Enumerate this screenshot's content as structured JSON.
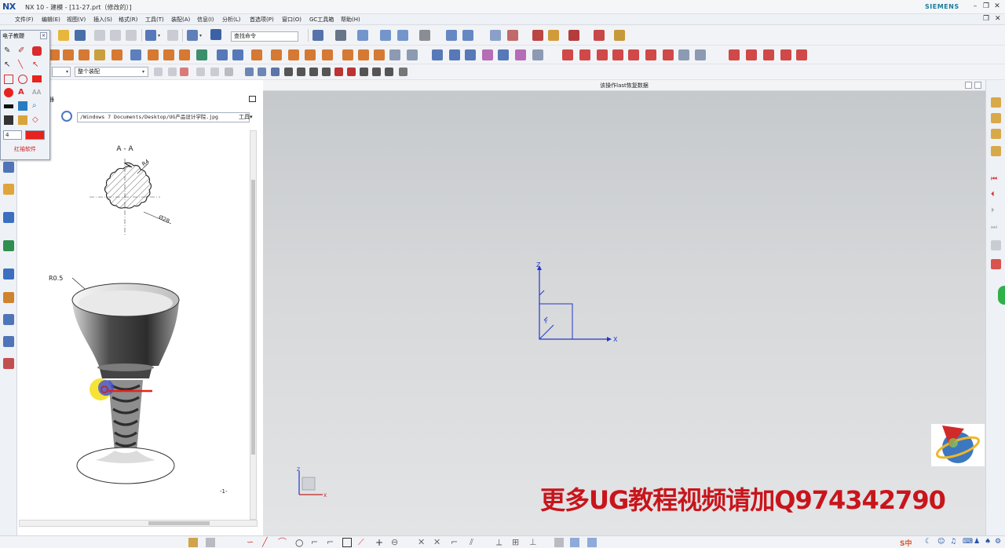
{
  "window": {
    "app_logo": "NX",
    "title": "NX 10 - 建模 - [11-27.prt（修改的）]",
    "brand": "SIEMENS",
    "controls": [
      "minimize-icon",
      "restore-icon",
      "close-icon"
    ]
  },
  "menu": {
    "items": [
      "文件(F)",
      "编辑(E)",
      "视图(V)",
      "插入(S)",
      "格式(R)",
      "工具(T)",
      "装配(A)",
      "信息(I)",
      "分析(L)",
      "首选项(P)",
      "窗口(O)",
      "GC工具箱",
      "帮助(H)"
    ]
  },
  "toolbar": {
    "search_placeholder": "查找命令",
    "selection_filter": "整个装配",
    "type_filter_value": ""
  },
  "palette": {
    "title": "电子教鞭",
    "close_label": "×",
    "line_width": "4",
    "footer": "红袖软件",
    "colors": {
      "red": "#e8221c",
      "black": "#111111"
    }
  },
  "browser": {
    "header_label": "器",
    "path": "/Windows 7 Documents/Desktop/UG产品设计学院.jpg",
    "tools_label": "工具▾",
    "drawing": {
      "section_label": "A - A",
      "dim_r": "R4",
      "dim_d": "Ø28",
      "fillet_label": "R0.5",
      "page_marker": "-1-"
    }
  },
  "viewport": {
    "title": "该操作last恢复数据",
    "axis_x": "X",
    "axis_y": "Y",
    "axis_z": "Z",
    "mini_x": "X",
    "mini_z": "Z"
  },
  "watermark": "更多UG教程视频请加Q974342790",
  "tray": {
    "ime": "S中"
  }
}
